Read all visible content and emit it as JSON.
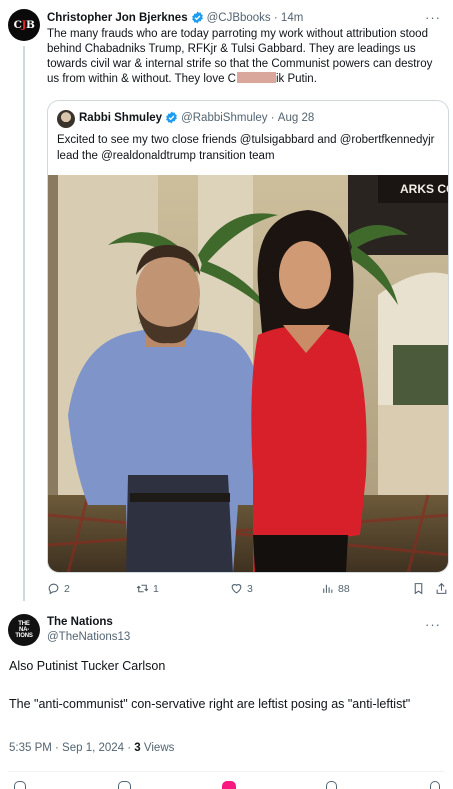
{
  "tweet": {
    "author_name": "Christopher Jon Bjerknes",
    "author_handle": "@CJBbooks",
    "time": "14m",
    "avatar_text": "CJB",
    "body_main": "The many frauds who are today parroting my work without attribution stood behind Chabadniks Trump, RFKjr & Tulsi Gabbard. They are leadings us towards civil war & internal strife so that the Communist powers can destroy us from within & without. They love C",
    "body_end": "ik Putin."
  },
  "quote": {
    "author_name": "Rabbi Shmuley",
    "author_handle": "@RabbiShmuley",
    "date": "Aug 28",
    "body": "Excited to see my two close friends @tulsigabbard and @robertfkennedyjr lead the @realdonaldtrump transition team",
    "photo_sign": "ARKS CO"
  },
  "actions": {
    "replies": "2",
    "reposts": "1",
    "likes": "3",
    "views": "88"
  },
  "reply": {
    "author_name": "The Nations",
    "author_handle": "@TheNations13",
    "avatar_lines": [
      "THE",
      "NA-",
      "TIONS"
    ],
    "paragraph1": "Also Putinist Tucker Carlson",
    "paragraph2": "The \"anti-communist\" con-servative right are leftist posing as \"anti-leftist\"",
    "timestamp": "5:35 PM · Sep 1, 2024 · ",
    "views_count": "3",
    "views_label": "Views"
  },
  "colors": {
    "verified": "#1d9bf0",
    "muted": "#536471",
    "border": "#cfd9de",
    "like_accent": "#f91880"
  }
}
